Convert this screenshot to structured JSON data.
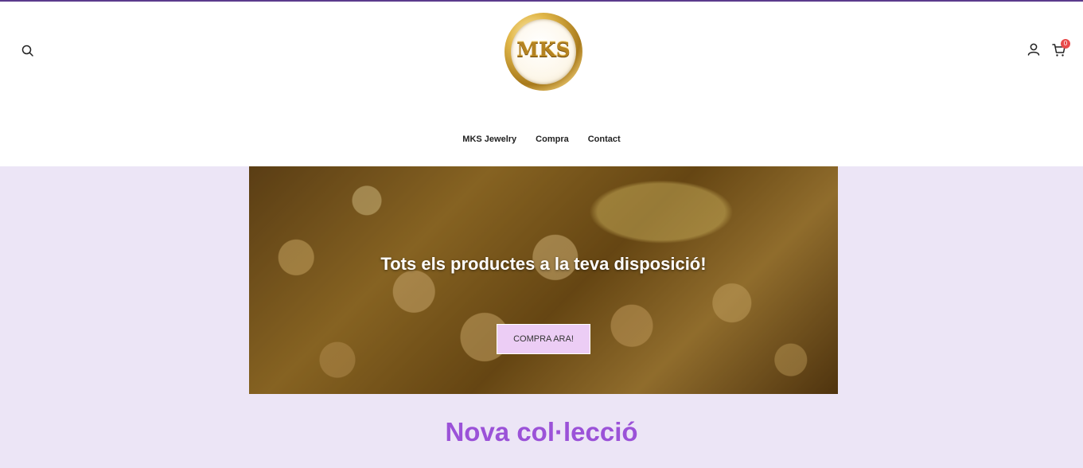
{
  "header": {
    "logo_text": "MKS",
    "cart_count": "0",
    "icons": {
      "search": "search-icon",
      "account": "user-icon",
      "cart": "cart-icon"
    }
  },
  "nav": {
    "items": [
      {
        "label": "MKS Jewelry"
      },
      {
        "label": "Compra"
      },
      {
        "label": "Contact"
      }
    ]
  },
  "hero": {
    "title": "Tots els productes a la teva disposició!",
    "button_label": "COMPRA ARA!"
  },
  "section": {
    "title": "Nova col·lecció"
  },
  "colors": {
    "page_background": "#ece5f6",
    "accent": "#9b52d8",
    "button_background": "#eccdf5",
    "badge": "#e84a4a",
    "top_border": "#5b3a8c"
  }
}
